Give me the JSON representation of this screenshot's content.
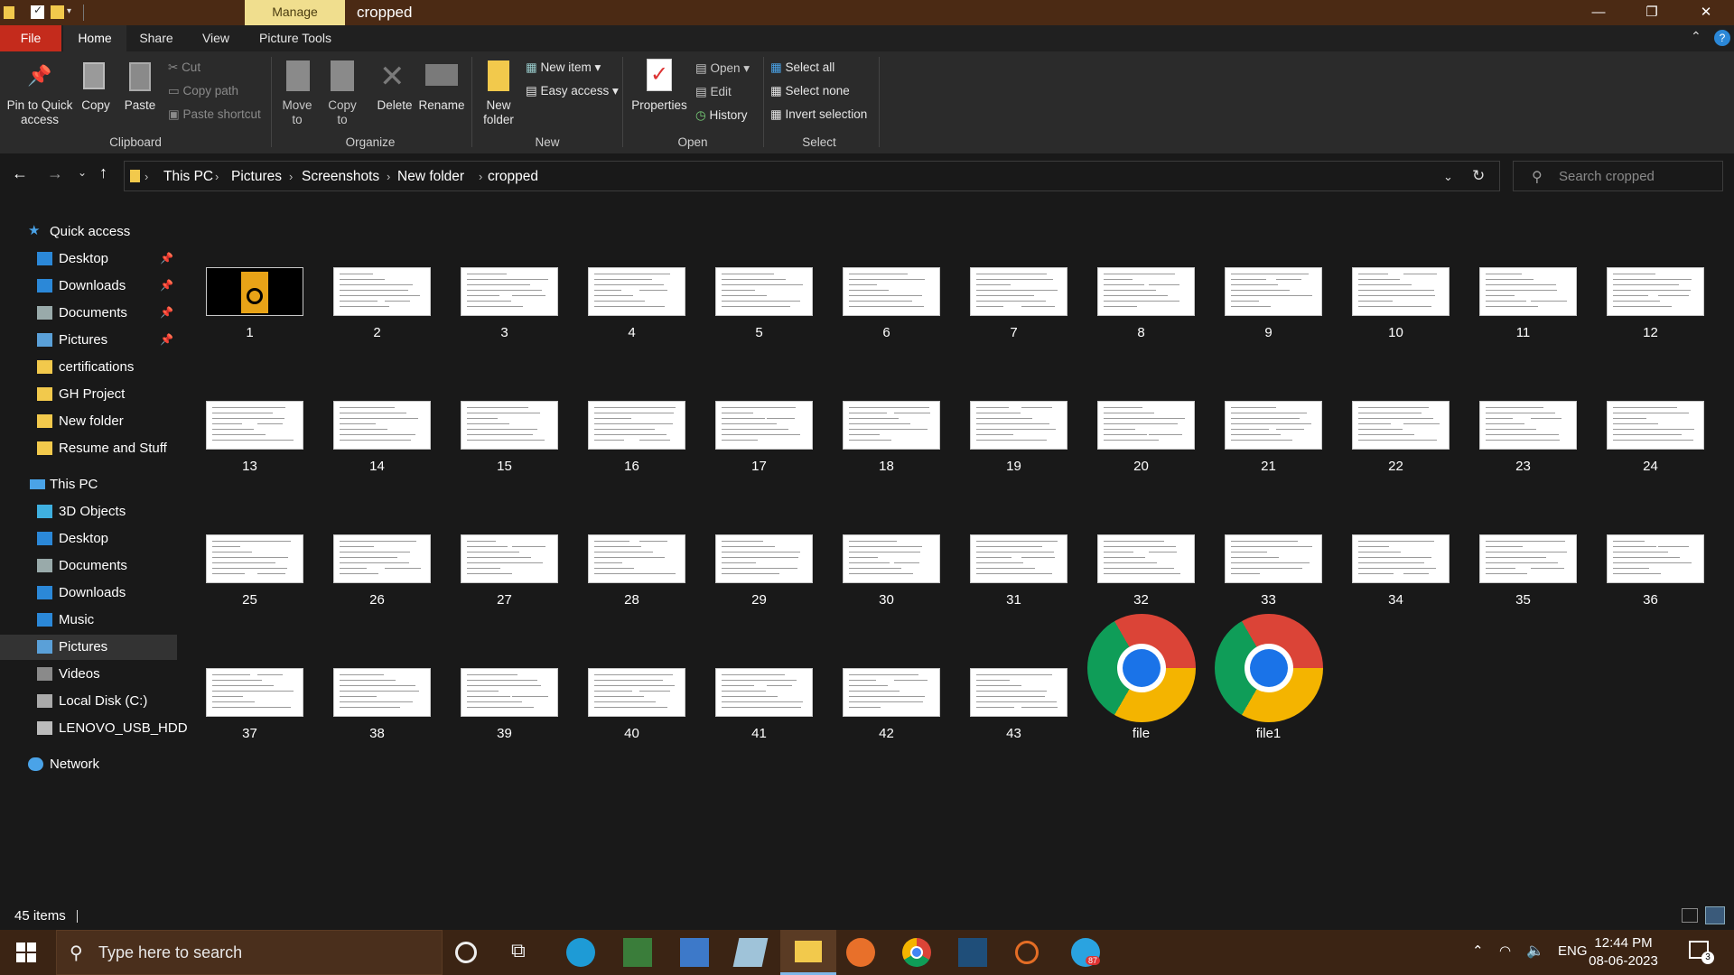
{
  "window": {
    "manage_tab": "Manage",
    "title": "cropped",
    "minimize": "—",
    "maximize": "❐",
    "close": "✕"
  },
  "ribbon_tabs": [
    "File",
    "Home",
    "Share",
    "View",
    "Picture Tools"
  ],
  "ribbon": {
    "clipboard": {
      "pin": "Pin to Quick access",
      "copy": "Copy",
      "paste": "Paste",
      "cut": "Cut",
      "copy_path": "Copy path",
      "paste_shortcut": "Paste shortcut",
      "group": "Clipboard"
    },
    "organize": {
      "move_to": "Move to",
      "copy_to": "Copy to",
      "delete": "Delete",
      "rename": "Rename",
      "group": "Organize"
    },
    "new": {
      "new_folder": "New folder",
      "new_item": "New item",
      "easy_access": "Easy access",
      "group": "New"
    },
    "open": {
      "properties": "Properties",
      "open": "Open",
      "edit": "Edit",
      "history": "History",
      "group": "Open"
    },
    "select": {
      "select_all": "Select all",
      "select_none": "Select none",
      "invert": "Invert selection",
      "group": "Select"
    }
  },
  "address": {
    "crumbs": [
      "This PC",
      "Pictures",
      "Screenshots",
      "New folder",
      "cropped"
    ],
    "search_placeholder": "Search cropped"
  },
  "nav": {
    "quick_access": "Quick access",
    "quick_items": [
      {
        "label": "Desktop",
        "icon": "desktop-icon",
        "pinned": true
      },
      {
        "label": "Downloads",
        "icon": "download-icon",
        "pinned": true
      },
      {
        "label": "Documents",
        "icon": "documents-icon",
        "pinned": true
      },
      {
        "label": "Pictures",
        "icon": "pictures-icon",
        "pinned": true
      },
      {
        "label": "certifications",
        "icon": "folder-icon",
        "pinned": false
      },
      {
        "label": "GH Project",
        "icon": "folder-icon",
        "pinned": false
      },
      {
        "label": "New folder",
        "icon": "folder-icon",
        "pinned": false
      },
      {
        "label": "Resume and Stuff",
        "icon": "folder-icon",
        "pinned": false
      }
    ],
    "this_pc": "This PC",
    "pc_items": [
      {
        "label": "3D Objects",
        "icon": "3d-objects-icon"
      },
      {
        "label": "Desktop",
        "icon": "desktop-icon"
      },
      {
        "label": "Documents",
        "icon": "documents-icon"
      },
      {
        "label": "Downloads",
        "icon": "download-icon"
      },
      {
        "label": "Music",
        "icon": "music-icon"
      },
      {
        "label": "Pictures",
        "icon": "pictures-icon"
      },
      {
        "label": "Videos",
        "icon": "videos-icon"
      },
      {
        "label": "Local Disk (C:)",
        "icon": "drive-icon"
      },
      {
        "label": "LENOVO_USB_HDD",
        "icon": "usb-drive-icon"
      }
    ],
    "network": "Network"
  },
  "files": [
    "1",
    "2",
    "3",
    "4",
    "5",
    "6",
    "7",
    "8",
    "9",
    "10",
    "11",
    "12",
    "13",
    "14",
    "15",
    "16",
    "17",
    "18",
    "19",
    "20",
    "21",
    "22",
    "23",
    "24",
    "25",
    "26",
    "27",
    "28",
    "29",
    "30",
    "31",
    "32",
    "33",
    "34",
    "35",
    "36",
    "37",
    "38",
    "39",
    "40",
    "41",
    "42",
    "43",
    "file",
    "file1"
  ],
  "status": {
    "items": "45 items"
  },
  "taskbar": {
    "search_placeholder": "Type here to search",
    "lang": "ENG",
    "time": "12:44 PM",
    "date": "08-06-2023",
    "notification_count": "3",
    "telegram_badge": "87"
  },
  "colors": {
    "title_bar": "#4b2a14",
    "manage_tab": "#f0de8e",
    "file_tab": "#c42b1c",
    "ribbon_bg": "#2b2b2b",
    "window_bg": "#191919",
    "taskbar": "#3b2414",
    "accent_blue": "#2b88d8",
    "folder_yellow": "#f2c94c"
  }
}
